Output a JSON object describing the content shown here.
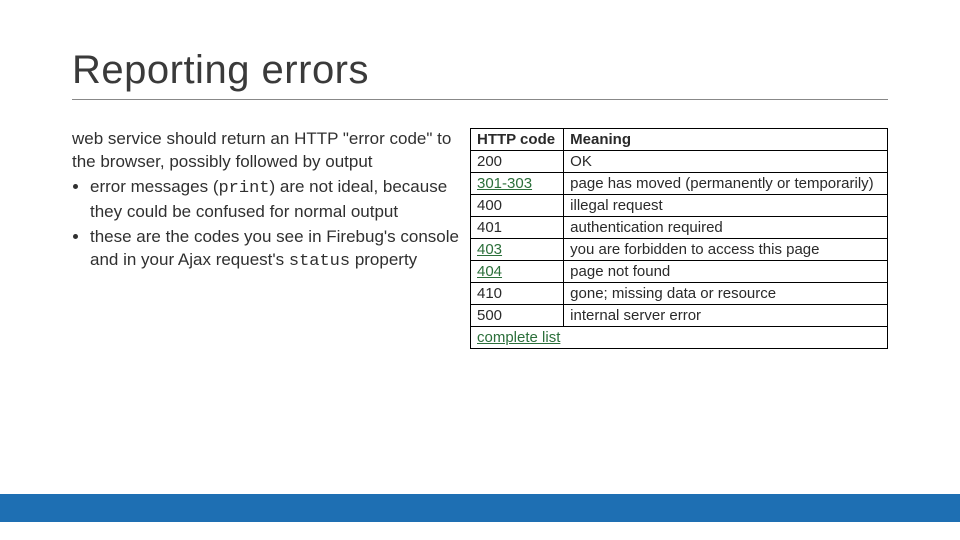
{
  "title": "Reporting errors",
  "left": {
    "intro": "web service should return an HTTP \"error code\" to the browser, possibly followed by output",
    "bullet1_pre": "error messages (",
    "bullet1_code": "print",
    "bullet1_post": ") are not ideal, because they could be confused for normal output",
    "bullet2_pre": "these are the codes you see in Firebug's console and in your Ajax request's ",
    "bullet2_code": "status",
    "bullet2_post": " property"
  },
  "table": {
    "header_code": "HTTP code",
    "header_meaning": "Meaning",
    "rows": [
      {
        "code": "200",
        "link": false,
        "meaning": "OK"
      },
      {
        "code": "301-303",
        "link": true,
        "meaning": "page has moved (permanently or temporarily)"
      },
      {
        "code": "400",
        "link": false,
        "meaning": "illegal request"
      },
      {
        "code": "401",
        "link": false,
        "meaning": "authentication required"
      },
      {
        "code": "403",
        "link": true,
        "meaning": "you are forbidden to access this page"
      },
      {
        "code": "404",
        "link": true,
        "meaning": "page not found"
      },
      {
        "code": "410",
        "link": false,
        "meaning": "gone; missing data or resource"
      },
      {
        "code": "500",
        "link": false,
        "meaning": "internal server error"
      }
    ],
    "footer_link": "complete list"
  }
}
